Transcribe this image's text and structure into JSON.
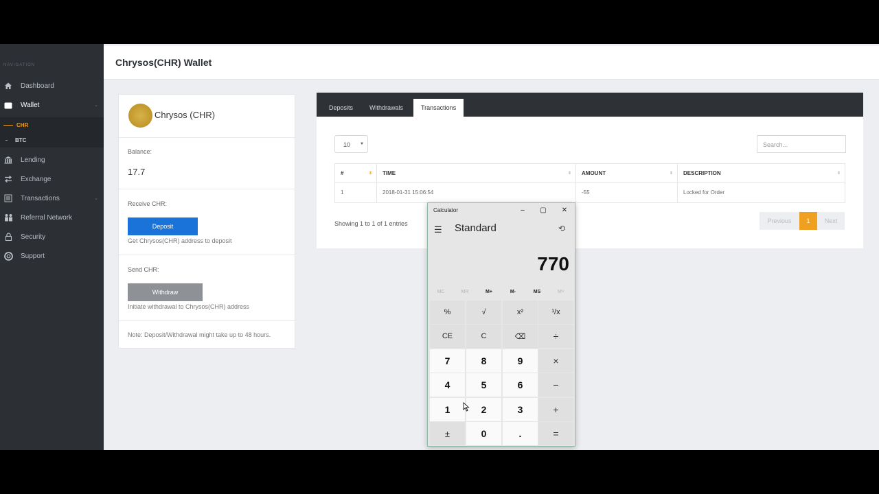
{
  "sidebar": {
    "caption": "NAVIGATION",
    "items": [
      {
        "label": "Dashboard",
        "icon": "home-icon"
      },
      {
        "label": "Wallet",
        "icon": "wallet-icon"
      },
      {
        "label": "Lending",
        "icon": "bank-icon"
      },
      {
        "label": "Exchange",
        "icon": "exchange-icon"
      },
      {
        "label": "Transactions",
        "icon": "list-icon"
      },
      {
        "label": "Referral Network",
        "icon": "users-icon"
      },
      {
        "label": "Security",
        "icon": "lock-icon"
      },
      {
        "label": "Support",
        "icon": "lifebuoy-icon"
      }
    ],
    "wallet_sub": [
      "CHR",
      "BTC"
    ]
  },
  "header": {
    "title": "Chrysos(CHR) Wallet"
  },
  "wallet_card": {
    "coin_name": "Chrysos (CHR)",
    "balance_label": "Balance:",
    "balance_value": "17.7",
    "receive_label": "Receive CHR:",
    "deposit_button": "Deposit",
    "deposit_hint": "Get Chrysos(CHR) address to deposit",
    "send_label": "Send CHR:",
    "withdraw_button": "Withdraw",
    "withdraw_hint": "Initiate withdrawal to Chrysos(CHR) address",
    "note": "Note: Deposit/Withdrawal might take up to 48 hours."
  },
  "tabs": [
    "Deposits",
    "Withdrawals",
    "Transactions"
  ],
  "table": {
    "page_length": "10",
    "search_placeholder": "Search...",
    "columns": [
      "#",
      "TIME",
      "AMOUNT",
      "DESCRIPTION"
    ],
    "rows": [
      {
        "num": "1",
        "time": "2018-01-31 15:06:54",
        "amount": "-55",
        "description": "Locked for Order"
      }
    ],
    "info": "Showing 1 to 1 of 1 entries",
    "pagination": {
      "previous": "Previous",
      "page": "1",
      "next": "Next"
    }
  },
  "calculator": {
    "title": "Calculator",
    "mode": "Standard",
    "display": "770",
    "memory": [
      "MC",
      "MR",
      "M+",
      "M-",
      "MS",
      "M˅"
    ],
    "keys": [
      [
        "%",
        "√",
        "x²",
        "¹/x"
      ],
      [
        "CE",
        "C",
        "⌫",
        "÷"
      ],
      [
        "7",
        "8",
        "9",
        "×"
      ],
      [
        "4",
        "5",
        "6",
        "−"
      ],
      [
        "1",
        "2",
        "3",
        "+"
      ],
      [
        "±",
        "0",
        ".",
        "="
      ]
    ]
  }
}
